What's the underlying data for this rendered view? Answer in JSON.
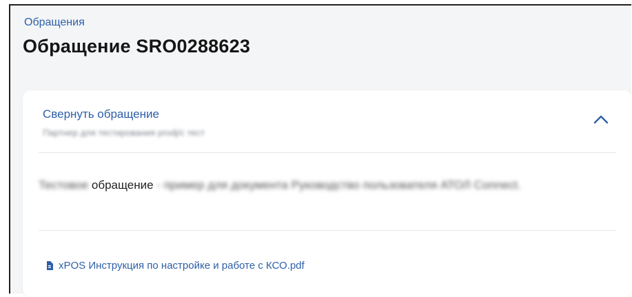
{
  "breadcrumb": "Обращения",
  "page_title": "Обращение SRO0288623",
  "card": {
    "collapse_label": "Свернуть обращение",
    "subtitle": "Партнер для тестирования prodj/c тест",
    "message": {
      "before": "Тестовое",
      "middle": " обращение ",
      "after": "- пример  для документа Руководство пользователя АТОЛ Connect."
    },
    "attachment_name": "xPOS Инструкция по настройке и работе с КСО.pdf"
  },
  "colors": {
    "accent": "#2d5fa8",
    "background": "#f4f5f7",
    "card": "#ffffff",
    "divider": "#e3e6ea"
  },
  "icons": [
    "chevron-up-icon",
    "file-icon"
  ]
}
